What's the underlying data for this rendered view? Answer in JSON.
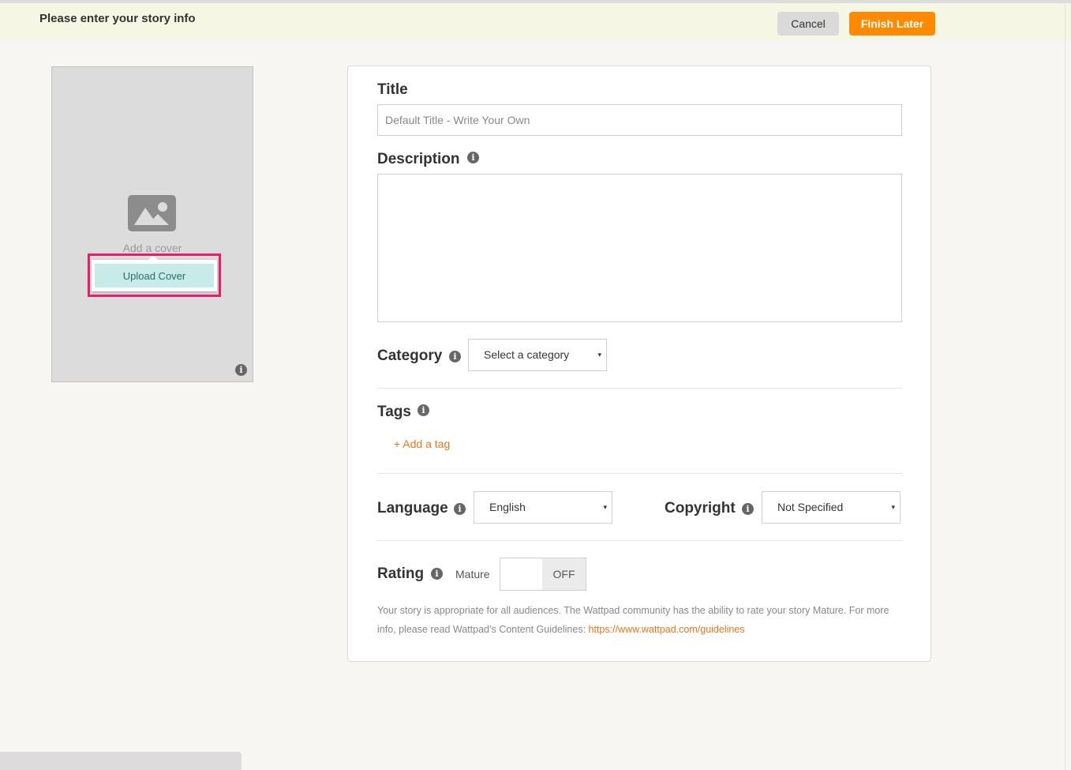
{
  "header": {
    "title": "Please enter your story info",
    "cancel_label": "Cancel",
    "finish_label": "Finish Later"
  },
  "cover": {
    "add_text": "Add a cover",
    "upload_label": "Upload Cover",
    "icon": "image-icon"
  },
  "form": {
    "title_label": "Title",
    "title_placeholder": "Default Title - Write Your Own",
    "title_value": "",
    "description_label": "Description",
    "description_value": "",
    "category_label": "Category",
    "category_value": "Select a category",
    "tags_label": "Tags",
    "add_tag": "+ Add a tag",
    "language_label": "Language",
    "language_value": "English",
    "copyright_label": "Copyright",
    "copyright_value": "Not Specified",
    "rating_label": "Rating",
    "mature_label": "Mature",
    "toggle_state": "OFF",
    "rating_text": "Your story is appropriate for all audiences. The Wattpad community has the ability to rate your story Mature. For more info, please read Wattpad’s Content Guidelines: ",
    "rating_link": "https://www.wattpad.com/guidelines"
  },
  "icons": {
    "info": "i",
    "dropdown": "▾"
  },
  "colors": {
    "accent": "#ff8a00",
    "link": "#e0771f",
    "highlight": "#ec1c6b",
    "upload_bg": "#c7ebe8"
  }
}
